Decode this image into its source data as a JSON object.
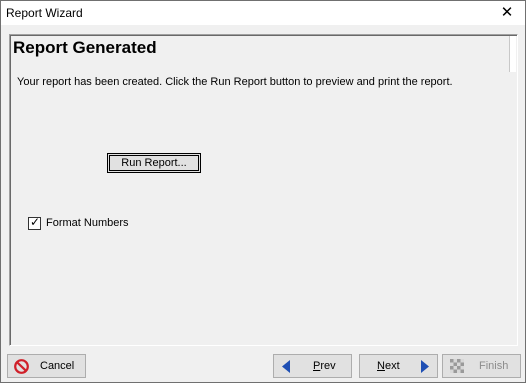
{
  "window": {
    "title": "Report Wizard",
    "close_glyph": "✕"
  },
  "panel": {
    "heading": "Report Generated",
    "description": "Your report has been created.  Click the Run Report button to preview and print the report."
  },
  "run_report": {
    "label": "Run Report..."
  },
  "format_numbers": {
    "label": "Format Numbers",
    "checked": true,
    "check_glyph": "✓"
  },
  "footer": {
    "cancel_label": "Cancel",
    "prev_label": "Prev",
    "next_label": "Next",
    "finish_label": "Finish"
  },
  "icons": {
    "cancel": "no-entry-icon",
    "prev": "arrow-left-icon",
    "next": "arrow-right-icon",
    "finish": "checkered-flag-icon"
  },
  "colors": {
    "cancel_icon": "#d0202a",
    "arrow": "#1e4fb4",
    "disabled_text": "#8c8c8c"
  }
}
